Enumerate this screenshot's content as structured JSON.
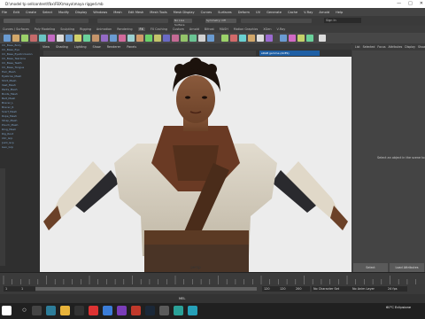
{
  "window": {
    "title": "D:\\model tp sellcontent\\fbx\\FBX\\maya\\maya rigged.mb",
    "controls": [
      "—",
      "□",
      "✕"
    ]
  },
  "menubar": [
    "File",
    "Edit",
    "Create",
    "Select",
    "Modify",
    "Display",
    "Windows",
    "Mesh",
    "Edit Mesh",
    "Mesh Tools",
    "Mesh Display",
    "Curves",
    "Surfaces",
    "Deform",
    "UV",
    "Generate",
    "Cache",
    "V-Ray",
    "Arnold",
    "Help"
  ],
  "status": {
    "no_live_surface": "No Live Surface",
    "symmetry": "Symmetry: Off",
    "sign_in": "Sign In"
  },
  "shelf_tabs": [
    "Curves / Surfaces",
    "Poly Modeling",
    "Sculpting",
    "Rigging",
    "Animation",
    "Rendering",
    "FX",
    "FX Caching",
    "Custom",
    "Arnold",
    "Bifrost",
    "MASH",
    "Motion Graphics",
    "XGen",
    "V-Ray"
  ],
  "shelf_active_index": 6,
  "panel_menu": [
    "View",
    "Shading",
    "Lighting",
    "Show",
    "Renderer",
    "Panels"
  ],
  "camera_field": "sRGB gamma (ACES)",
  "watermark": "persp",
  "outliner_rows": [
    "CC_Base_Body",
    "CC_Base_Eye",
    "CC_Base_EyeOcclusion",
    "CC_Base_TearLine",
    "CC_Base_Teeth",
    "CC_Base_Tongue",
    "Hair_Mesh",
    "Eyebrow_Mesh",
    "Shirt_Mesh",
    "Vest_Mesh",
    "Pants_Mesh",
    "Boots_Mesh",
    "Belt_Mesh",
    "Bracer_L",
    "Bracer_R",
    "Scarf_Mesh",
    "Rope_Mesh",
    "Strap_Mesh",
    "Pouch_Mesh",
    "Ring_Mesh",
    "Rig_Root",
    "Ctrl_Grp",
    "Joint_Grp",
    "Geo_Grp"
  ],
  "right_panel": {
    "tabs": [
      "List",
      "Selected",
      "Focus",
      "Attributes",
      "Display",
      "Show",
      "Help"
    ],
    "message": "Select an object in the scene to",
    "buttons": [
      "Select",
      "Load Attributes"
    ]
  },
  "range": {
    "start": "1",
    "inner_start": "1",
    "inner_end": "120",
    "end": "120",
    "end2": "200",
    "character_set": "No Character Set",
    "anim_layer": "No Anim Layer",
    "fps": "24 fps"
  },
  "command_line": {
    "label": "MEL"
  },
  "taskbar": {
    "weather": "60°C  Eclipsione"
  }
}
